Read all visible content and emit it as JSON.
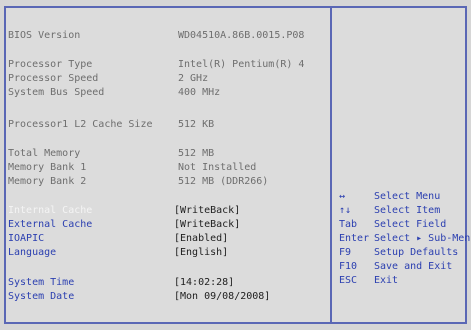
{
  "info": {
    "bios_version_label": "BIOS Version",
    "bios_version_value": "WD04510A.86B.0015.P08",
    "processor_type_label": "Processor Type",
    "processor_type_value": "Intel(R) Pentium(R) 4",
    "processor_speed_label": "Processor Speed",
    "processor_speed_value": "2 GHz",
    "bus_speed_label": "System Bus Speed",
    "bus_speed_value": "400 MHz",
    "l2_cache_label": "Processor1 L2 Cache Size",
    "l2_cache_value": "512 KB",
    "total_memory_label": "Total Memory",
    "total_memory_value": "512 MB",
    "bank1_label": "Memory Bank 1",
    "bank1_value": "Not Installed",
    "bank2_label": "Memory Bank 2",
    "bank2_value": "512 MB (DDR266)"
  },
  "settings": {
    "internal_cache_label": "Internal Cache",
    "internal_cache_value": "[WriteBack]",
    "external_cache_label": "External Cache",
    "external_cache_value": "[WriteBack]",
    "ioapic_label": "IOAPIC",
    "ioapic_value": "[Enabled]",
    "language_label": "Language",
    "language_value": "[English]",
    "time_label": "System Time",
    "time_value": "[14:02:28]",
    "date_label": "System Date",
    "date_value": "[Mon 09/08/2008]"
  },
  "help": [
    {
      "key": "↔",
      "desc": "Select Menu"
    },
    {
      "key": "↑↓",
      "desc": "Select Item"
    },
    {
      "key": "Tab",
      "desc": "Select Field"
    },
    {
      "key": "Enter",
      "desc": "Select ▸ Sub-Menu"
    },
    {
      "key": "F9",
      "desc": "Setup Defaults"
    },
    {
      "key": "F10",
      "desc": "Save and Exit"
    },
    {
      "key": "ESC",
      "desc": "Exit"
    }
  ],
  "colors": {
    "background": "#dcdcdc",
    "border": "#5a67b5",
    "label_gray": "#6e6e6e",
    "highlight_blue": "#2b3fb0",
    "selected_white": "#f4f4f4"
  }
}
